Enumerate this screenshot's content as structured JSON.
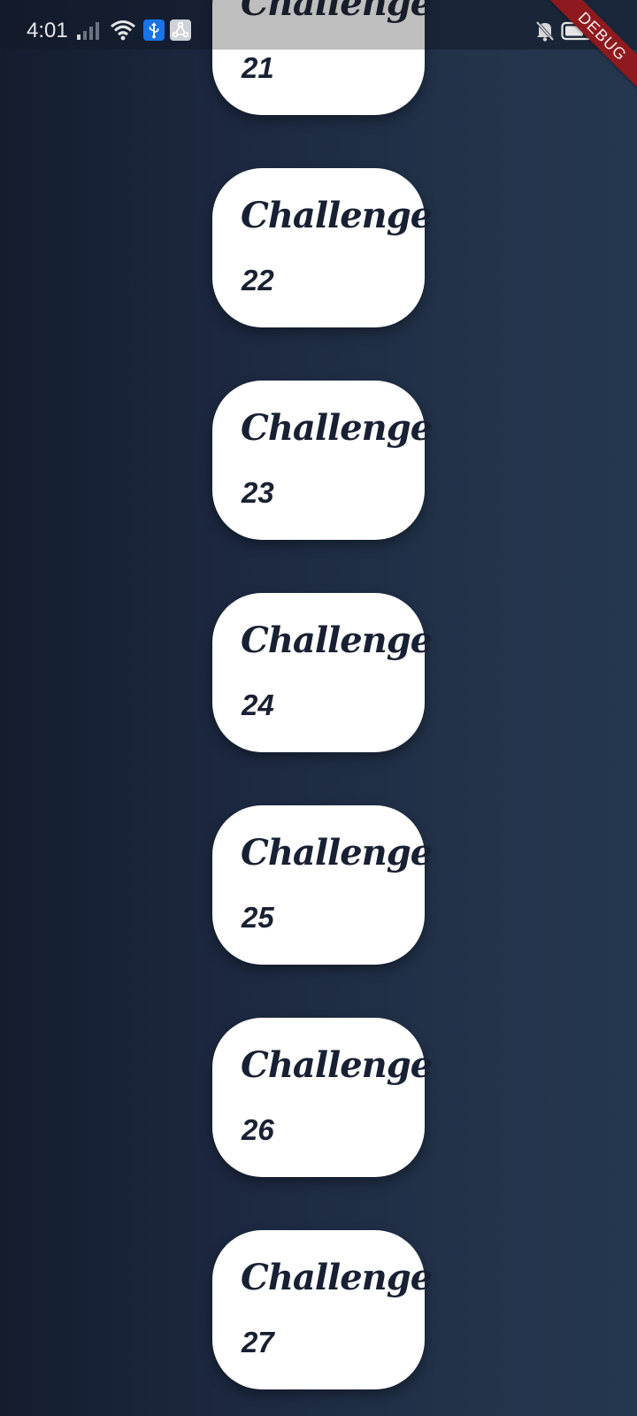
{
  "status_bar": {
    "time": "4:01",
    "icons": [
      "signal-icon",
      "wifi-icon",
      "usb-icon",
      "share-icon",
      "mute-icon",
      "battery-icon",
      "charge-icon"
    ]
  },
  "debug_banner": "DEBUG",
  "challenges": [
    {
      "title": "Challenge",
      "number": "21"
    },
    {
      "title": "Challenge",
      "number": "22"
    },
    {
      "title": "Challenge",
      "number": "23"
    },
    {
      "title": "Challenge",
      "number": "24"
    },
    {
      "title": "Challenge",
      "number": "25"
    },
    {
      "title": "Challenge",
      "number": "26"
    },
    {
      "title": "Challenge",
      "number": "27"
    }
  ],
  "colors": {
    "background_start": "#141d2e",
    "background_end": "#25374f",
    "card": "#ffffff",
    "card_text": "#182033",
    "debug_banner": "#8e1a1f"
  }
}
